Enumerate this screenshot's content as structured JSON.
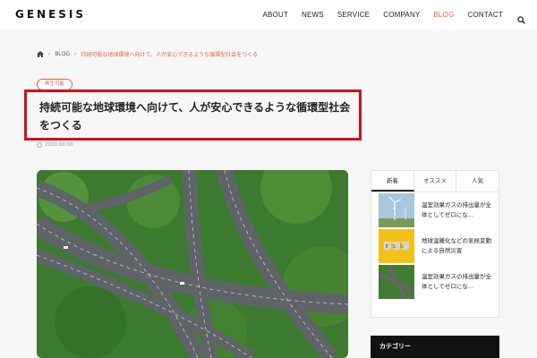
{
  "header": {
    "logo": "GENESIS",
    "nav": [
      "ABOUT",
      "NEWS",
      "SERVICE",
      "COMPANY",
      "BLOG",
      "CONTACT"
    ],
    "active_nav": "BLOG"
  },
  "breadcrumb": {
    "blog": "BLOG",
    "current": "持続可能な地球環境へ向けて、人が安心できるような循環型社会をつくる"
  },
  "article": {
    "category": "再生可能",
    "title": "持続可能な地球環境へ向けて、人が安心できるような循環型社会をつくる",
    "date": "2020.00.00"
  },
  "sidebar": {
    "tabs": [
      "新着",
      "オススメ",
      "人気"
    ],
    "active_tab": "新着",
    "posts": [
      {
        "title": "温室効果ガスの排出量が全体としてゼロにな…"
      },
      {
        "title": "地球温暖化などの気候変動による自然災害"
      },
      {
        "title": "温室効果ガスの排出量が全体としてゼロにな…"
      }
    ],
    "thumb_text": "ESG",
    "category_heading": "カテゴリー"
  },
  "colors": {
    "accent": "#e8603c",
    "highlight_border": "#d0101b",
    "category_bar": "#111111"
  }
}
